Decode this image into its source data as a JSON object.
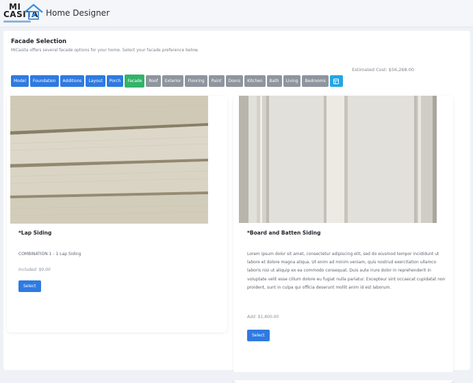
{
  "header": {
    "logo_top": "MI",
    "logo_bottom": "CASITA",
    "app_title": "Home Designer"
  },
  "section": {
    "title": "Facade Selection",
    "description": "MiCasita offers several facade options for your home. Select your facade preference below."
  },
  "estimated_cost": "Estimated Cost: $56,268.00",
  "tabs": [
    {
      "label": "Model",
      "state": "complete"
    },
    {
      "label": "Foundation",
      "state": "complete"
    },
    {
      "label": "Additions",
      "state": "complete"
    },
    {
      "label": "Layout",
      "state": "complete"
    },
    {
      "label": "Porch",
      "state": "complete"
    },
    {
      "label": "Facade",
      "state": "active"
    },
    {
      "label": "Roof",
      "state": "pending"
    },
    {
      "label": "Exterior",
      "state": "pending"
    },
    {
      "label": "Flooring",
      "state": "pending"
    },
    {
      "label": "Paint",
      "state": "pending"
    },
    {
      "label": "Doors",
      "state": "pending"
    },
    {
      "label": "Kitchen",
      "state": "pending"
    },
    {
      "label": "Bath",
      "state": "pending"
    },
    {
      "label": "Living",
      "state": "pending"
    },
    {
      "label": "Bedrooms",
      "state": "pending"
    },
    {
      "icon": "grid-icon"
    }
  ],
  "options": [
    {
      "name": "*Lap Siding",
      "description": "COMBINATION 1 - 1 Lap Siding",
      "price": "Included: $0.00",
      "button": "Select"
    },
    {
      "name": "*Board and Batten Siding",
      "description": "Lorem ipsum dolor sit amet, consectetur adipiscing elit, sed do eiusmod tempor incididunt ut labore et dolore magna aliqua. Ut enim ad minim veniam, quis nostrud exercitation ullamco laboris nisi ut aliquip ex ea commodo consequat. Duis aute irure dolor in reprehenderit in voluptate velit esse cillum dolore eu fugiat nulla pariatur. Excepteur sint occaecat cupidatat non proident, sunt in culpa qui officia deserunt mollit anim id est laborum.",
      "price": "Add: $1,800.00",
      "button": "Select"
    }
  ],
  "colors": {
    "complete": "#2f7ae0",
    "active": "#34b36a",
    "pending": "#8f959e",
    "icon_button": "#22a6e6"
  }
}
